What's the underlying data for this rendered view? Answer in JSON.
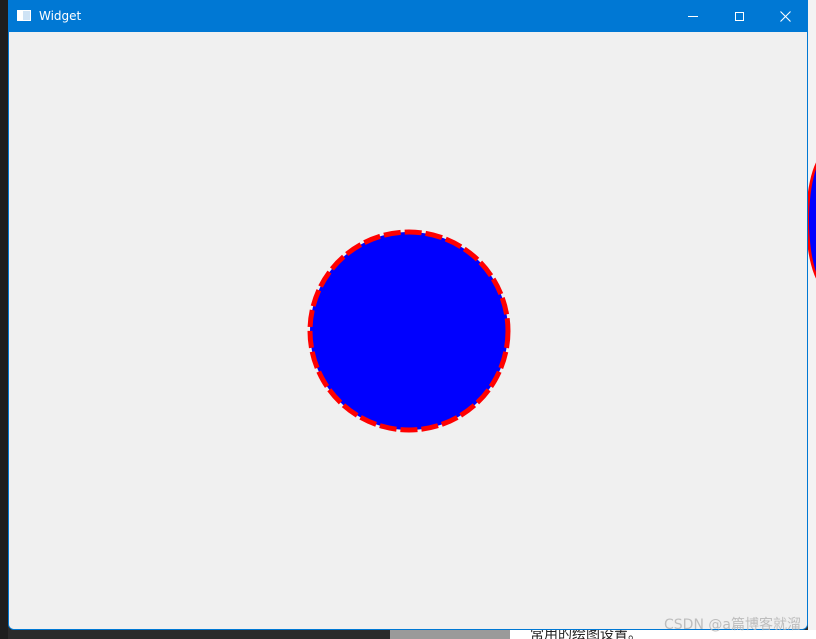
{
  "window": {
    "title": "Widget",
    "accent_color": "#0078d4",
    "background_color": "#f0f0f0"
  },
  "titlebar": {
    "icons": {
      "app": "app-window-icon",
      "minimize": "minimize-icon",
      "maximize": "maximize-icon",
      "close": "close-icon"
    }
  },
  "canvas": {
    "shape": "circle",
    "fill_color": "#0000ff",
    "stroke_color": "#ff0000",
    "stroke_style": "dashed"
  },
  "background": {
    "bottom_text": "常用的绘图设置。",
    "watermark": "CSDN @a篇博客就溜"
  }
}
